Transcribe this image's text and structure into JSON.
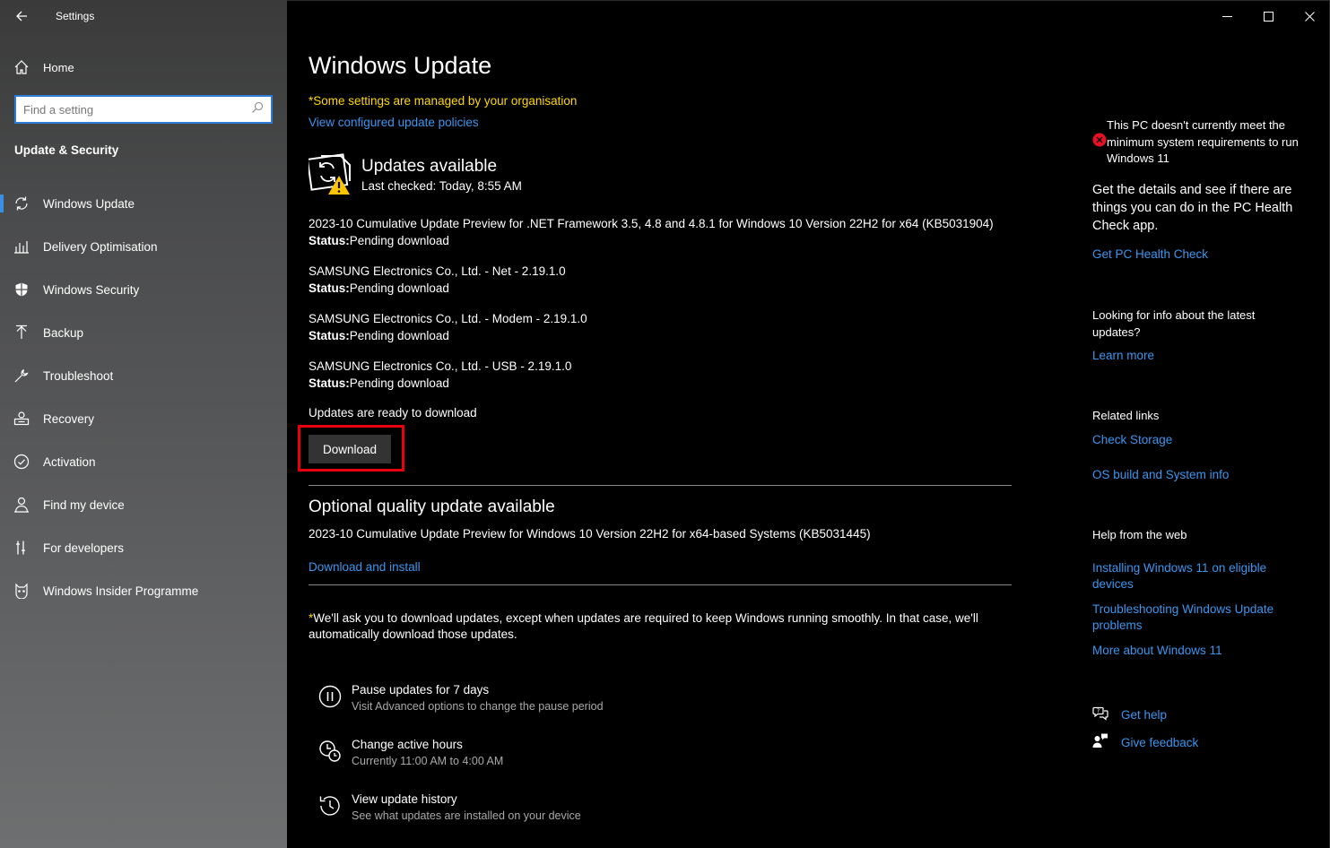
{
  "window": {
    "title": "Settings",
    "controls": [
      "minimize-icon",
      "maximize-icon",
      "close-icon"
    ]
  },
  "sidebar": {
    "home_label": "Home",
    "search_placeholder": "Find a setting",
    "section_heading": "Update & Security",
    "items": [
      {
        "label": "Windows Update",
        "icon": "refresh-icon",
        "active": true
      },
      {
        "label": "Delivery Optimisation",
        "icon": "delivery-icon",
        "active": false
      },
      {
        "label": "Windows Security",
        "icon": "shield-icon",
        "active": false
      },
      {
        "label": "Backup",
        "icon": "backup-icon",
        "active": false
      },
      {
        "label": "Troubleshoot",
        "icon": "wrench-icon",
        "active": false
      },
      {
        "label": "Recovery",
        "icon": "recovery-icon",
        "active": false
      },
      {
        "label": "Activation",
        "icon": "check-circle-icon",
        "active": false
      },
      {
        "label": "Find my device",
        "icon": "person-icon",
        "active": false
      },
      {
        "label": "For developers",
        "icon": "developer-icon",
        "active": false
      },
      {
        "label": "Windows Insider Programme",
        "icon": "insider-icon",
        "active": false
      }
    ]
  },
  "main": {
    "title": "Windows Update",
    "managed_note": "*Some settings are managed by your organisation",
    "policies_link": "View configured update policies",
    "status_title": "Updates available",
    "status_sub": "Last checked: Today, 8:55 AM",
    "status_label": "Status:",
    "updates": [
      {
        "name": "2023-10 Cumulative Update Preview for .NET Framework 3.5, 4.8 and 4.8.1 for Windows 10 Version 22H2 for x64 (KB5031904)",
        "status": "Pending download"
      },
      {
        "name": "SAMSUNG Electronics Co., Ltd.  - Net - 2.19.1.0",
        "status": "Pending download"
      },
      {
        "name": "SAMSUNG Electronics Co., Ltd.  - Modem - 2.19.1.0",
        "status": "Pending download"
      },
      {
        "name": "SAMSUNG Electronics Co., Ltd.  - USB - 2.19.1.0",
        "status": "Pending download"
      }
    ],
    "ready_text": "Updates are ready to download",
    "download_label": "Download",
    "optional_title": "Optional quality update available",
    "optional_desc": "2023-10 Cumulative Update Preview for Windows 10 Version 22H2 for x64-based Systems (KB5031445)",
    "optional_link": "Download and install",
    "footnote_star": "*",
    "footnote": "We'll ask you to download updates, except when updates are required to keep Windows running smoothly. In that case, we'll automatically download those updates.",
    "options": [
      {
        "title": "Pause updates for 7 days",
        "sub": "Visit Advanced options to change the pause period",
        "icon": "pause-icon"
      },
      {
        "title": "Change active hours",
        "sub": "Currently 11:00 AM to 4:00 AM",
        "icon": "active-hours-icon"
      },
      {
        "title": "View update history",
        "sub": "See what updates are installed on your device",
        "icon": "history-icon"
      }
    ]
  },
  "right": {
    "w11_warning": "This PC doesn't currently meet the minimum system requirements to run Windows 11",
    "health_desc": "Get the details and see if there are things you can do in the PC Health Check app.",
    "health_link": "Get PC Health Check",
    "info_question": "Looking for info about the latest updates?",
    "learn_more": "Learn more",
    "related_heading": "Related links",
    "check_storage": "Check Storage",
    "os_build": "OS build and System info",
    "help_heading": "Help from the web",
    "help_links": [
      "Installing Windows 11 on eligible devices",
      "Troubleshooting Windows Update problems",
      "More about Windows 11"
    ],
    "get_help": "Get help",
    "give_feedback": "Give feedback"
  },
  "colors": {
    "accent": "#3a96ee",
    "warning_yellow": "#ffd800",
    "highlight_red": "#e8000d",
    "error_red": "#e81123"
  }
}
